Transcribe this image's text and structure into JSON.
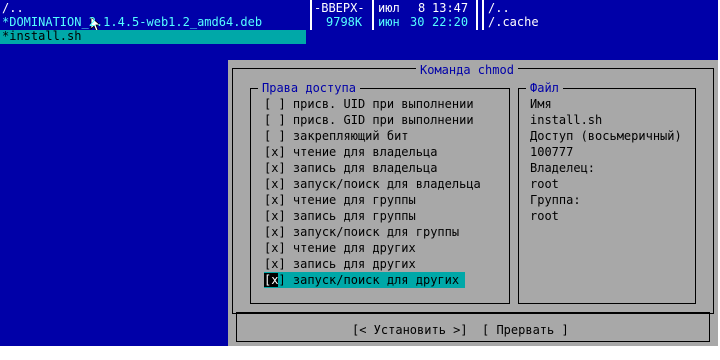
{
  "left_panel": {
    "up_dir": "/..",
    "files": [
      {
        "name": "*DOMINATION_2.1.4.5-web1.2_amd64.deb"
      },
      {
        "name": "*install.sh"
      }
    ],
    "mini_info": {
      "size": "-ВВЕРХ-",
      "date_month": "июл",
      "date_day": "8",
      "time": "13:47"
    },
    "mini_info2": {
      "size": "9798K",
      "date_month": "июн",
      "date_day": "30",
      "time": "22:20"
    }
  },
  "right_panel": {
    "up_dir": "/..",
    "cache_dir": "/.cache"
  },
  "dialog": {
    "title": "Команда chmod",
    "permissions_title": "Права доступа",
    "permissions": [
      {
        "checked": " ",
        "label": "присв. UID при выполнении"
      },
      {
        "checked": " ",
        "label": "присв. GID при выполнении"
      },
      {
        "checked": " ",
        "label": "закрепляющий бит"
      },
      {
        "checked": "x",
        "label": "чтение для владельца"
      },
      {
        "checked": "x",
        "label": "запись для владельца"
      },
      {
        "checked": "x",
        "label": "запуск/поиск для владельца"
      },
      {
        "checked": "x",
        "label": "чтение для группы"
      },
      {
        "checked": "x",
        "label": "запись для группы"
      },
      {
        "checked": "x",
        "label": "запуск/поиск для группы"
      },
      {
        "checked": "x",
        "label": "чтение для других"
      },
      {
        "checked": "x",
        "label": "запись для других"
      },
      {
        "checked": "x",
        "label": "запуск/поиск для других"
      }
    ],
    "file_title": "Файл",
    "file_info": {
      "name_label": "Имя",
      "name_value": "install.sh",
      "octal_label": "Доступ (восьмеричный)",
      "octal_value": "100777",
      "owner_label": "Владелец:",
      "owner_value": "root",
      "group_label": "Группа:",
      "group_value": "root"
    },
    "set_button": "[< Установить >]",
    "cancel_button": "[ Прервать ]"
  },
  "colors": {
    "panel_bg": "#0000a8",
    "dialog_bg": "#a8a8a8",
    "selection_bg": "#00a8a8",
    "highlight_fg": "#55ffff"
  },
  "icons": [
    "mouse-pointer-icon"
  ]
}
